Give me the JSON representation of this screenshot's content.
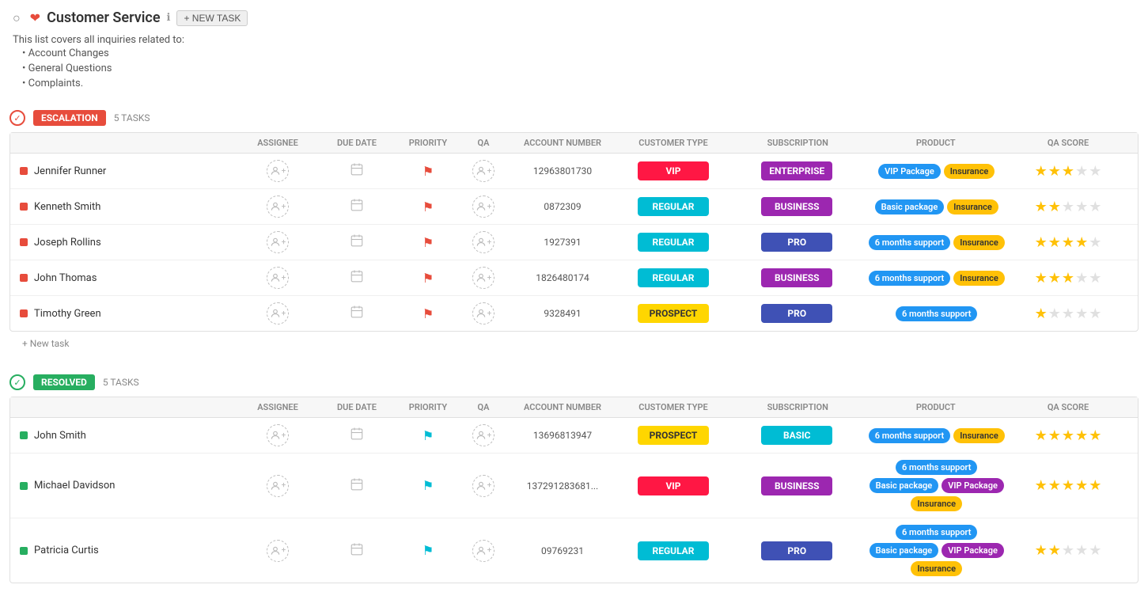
{
  "header": {
    "back_label": "←",
    "heart_icon": "❤",
    "title": "Customer Service",
    "info_icon": "ℹ",
    "new_task_label": "+ NEW TASK"
  },
  "description": {
    "intro": "This list covers all inquiries related to:",
    "items": [
      "Account Changes",
      "General Questions",
      "Complaints."
    ]
  },
  "columns": {
    "assignee": "ASSIGNEE",
    "due_date": "DUE DATE",
    "priority": "PRIORITY",
    "qa": "QA",
    "account_number": "ACCOUNT NUMBER",
    "customer_type": "CUSTOMER TYPE",
    "subscription": "SUBSCRIPTION",
    "product": "PRODUCT",
    "qa_score": "QA SCORE"
  },
  "escalation": {
    "label": "ESCALATION",
    "count": "5 TASKS",
    "new_task_label": "+ New task",
    "tasks": [
      {
        "name": "Jennifer Runner",
        "account_number": "12963801730",
        "customer_type": "VIP",
        "customer_type_class": "customer-vip",
        "subscription": "ENTERPRISE",
        "subscription_class": "sub-enterprise",
        "products": [
          {
            "label": "VIP Package",
            "class": "tag-blue"
          },
          {
            "label": "Insurance",
            "class": "tag-yellow"
          }
        ],
        "stars": 3,
        "flag_class": "flag-red"
      },
      {
        "name": "Kenneth Smith",
        "account_number": "0872309",
        "customer_type": "REGULAR",
        "customer_type_class": "customer-regular",
        "subscription": "BUSINESS",
        "subscription_class": "sub-business",
        "products": [
          {
            "label": "Basic package",
            "class": "tag-blue"
          },
          {
            "label": "Insurance",
            "class": "tag-yellow"
          }
        ],
        "stars": 2,
        "flag_class": "flag-red"
      },
      {
        "name": "Joseph Rollins",
        "account_number": "1927391",
        "customer_type": "REGULAR",
        "customer_type_class": "customer-regular",
        "subscription": "PRO",
        "subscription_class": "sub-pro",
        "products": [
          {
            "label": "6 months support",
            "class": "tag-blue"
          },
          {
            "label": "Insurance",
            "class": "tag-yellow"
          }
        ],
        "stars": 4,
        "flag_class": "flag-red"
      },
      {
        "name": "John Thomas",
        "account_number": "1826480174",
        "customer_type": "REGULAR",
        "customer_type_class": "customer-regular",
        "subscription": "BUSINESS",
        "subscription_class": "sub-business",
        "products": [
          {
            "label": "6 months support",
            "class": "tag-blue"
          },
          {
            "label": "Insurance",
            "class": "tag-yellow"
          }
        ],
        "stars": 3,
        "flag_class": "flag-red"
      },
      {
        "name": "Timothy Green",
        "account_number": "9328491",
        "customer_type": "PROSPECT",
        "customer_type_class": "customer-prospect",
        "subscription": "PRO",
        "subscription_class": "sub-pro",
        "products": [
          {
            "label": "6 months support",
            "class": "tag-blue"
          }
        ],
        "stars": 1,
        "flag_class": "flag-red"
      }
    ]
  },
  "resolved": {
    "label": "RESOLVED",
    "count": "5 TASKS",
    "tasks": [
      {
        "name": "John Smith",
        "account_number": "13696813947",
        "customer_type": "PROSPECT",
        "customer_type_class": "customer-prospect",
        "subscription": "BASIC",
        "subscription_class": "sub-basic",
        "products": [
          {
            "label": "6 months support",
            "class": "tag-blue"
          },
          {
            "label": "Insurance",
            "class": "tag-yellow"
          }
        ],
        "stars": 5,
        "flag_class": "flag-cyan"
      },
      {
        "name": "Michael Davidson",
        "account_number": "137291283681...",
        "customer_type": "VIP",
        "customer_type_class": "customer-vip",
        "subscription": "BUSINESS",
        "subscription_class": "sub-business",
        "products": [
          {
            "label": "6 months support",
            "class": "tag-blue"
          },
          {
            "label": "Basic package",
            "class": "tag-blue"
          },
          {
            "label": "VIP Package",
            "class": "tag-purple"
          },
          {
            "label": "Insurance",
            "class": "tag-yellow"
          }
        ],
        "stars": 5,
        "flag_class": "flag-cyan"
      },
      {
        "name": "Patricia Curtis",
        "account_number": "09769231",
        "customer_type": "REGULAR",
        "customer_type_class": "customer-regular",
        "subscription": "PRO",
        "subscription_class": "sub-pro",
        "products": [
          {
            "label": "6 months support",
            "class": "tag-blue"
          },
          {
            "label": "Basic package",
            "class": "tag-blue"
          },
          {
            "label": "VIP Package",
            "class": "tag-purple"
          },
          {
            "label": "Insurance",
            "class": "tag-yellow"
          }
        ],
        "stars": 2,
        "flag_class": "flag-cyan"
      }
    ]
  }
}
